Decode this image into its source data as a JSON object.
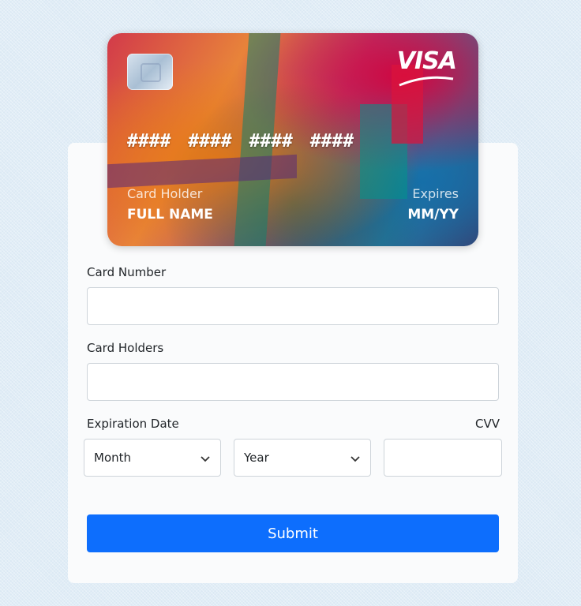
{
  "card": {
    "brand": "VISA",
    "number": "#### #### #### ####",
    "holder_label": "Card Holder",
    "holder_value": "FULL NAME",
    "expires_label": "Expires",
    "expires_value": "MM/YY"
  },
  "form": {
    "card_number_label": "Card Number",
    "card_number_value": "",
    "card_holders_label": "Card Holders",
    "card_holders_value": "",
    "expiration_label": "Expiration Date",
    "month_selected": "Month",
    "year_selected": "Year",
    "cvv_label": "CVV",
    "cvv_value": "",
    "submit_label": "Submit"
  },
  "colors": {
    "accent": "#0d6efd",
    "page_bg": "#dbe9f4",
    "panel_bg": "#fafbfc"
  },
  "icons": [
    "chip-icon",
    "visa-logo",
    "chevron-down-icon"
  ]
}
